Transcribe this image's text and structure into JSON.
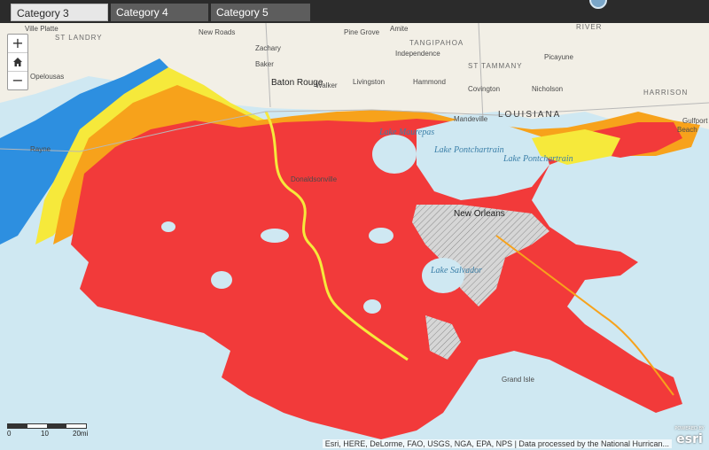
{
  "tabs": [
    {
      "label": "Category 3",
      "active": true
    },
    {
      "label": "Category 4",
      "active": false
    },
    {
      "label": "Category 5",
      "active": false
    }
  ],
  "zoom": {
    "in": "+",
    "home": "home-icon",
    "out": "−"
  },
  "colors": {
    "surge_high": "#f23a3a",
    "surge_mid": "#f7a21b",
    "surge_low": "#f6e93b",
    "surge_min": "#2d8fe0",
    "water": "#cfe8f2",
    "land": "#f2efe6",
    "levee": "#c9c9c9"
  },
  "labels": {
    "ville_platte": "Ville Platte",
    "st_landry": "ST LANDRY",
    "opelousas": "Opelousas",
    "new_roads": "New Roads",
    "zachary": "Zachary",
    "baker": "Baker",
    "baton_rouge": "Baton Rouge",
    "pine_grove": "Pine Grove",
    "amite": "Amite",
    "tangipahoa": "TANGIPAHOA",
    "independence": "Independence",
    "walker": "Walker",
    "livingston": "Livingston",
    "hammond": "Hammond",
    "st_tammany": "ST TAMMANY",
    "covington": "Covington",
    "picayune": "Picayune",
    "nicholson": "Nicholson",
    "river": "RIVER",
    "harrison": "HARRISON",
    "louisiana": "LOUISIANA",
    "mandeville": "Mandeville",
    "lake_maurepas": "Lake Maurepas",
    "lake_pontchartrain": "Lake Pontchartrain",
    "lake_pontchartrain_2": "Lake Pontchartrain",
    "donaldsonville": "Donaldsonville",
    "new_orleans": "New Orleans",
    "lake_salvador": "Lake Salvador",
    "grand_isle": "Grand Isle",
    "gulfport": "Gulfport",
    "rayne": "Rayne",
    "beach": "Beach"
  },
  "scale": {
    "zero": "0",
    "ten": "10",
    "twenty": "20mi"
  },
  "attribution": "Esri, HERE, DeLorme, FAO, USGS, NGA, EPA, NPS | Data processed by the National Hurrican...",
  "esri_logo": {
    "powered": "POWERED BY",
    "brand": "esri"
  }
}
